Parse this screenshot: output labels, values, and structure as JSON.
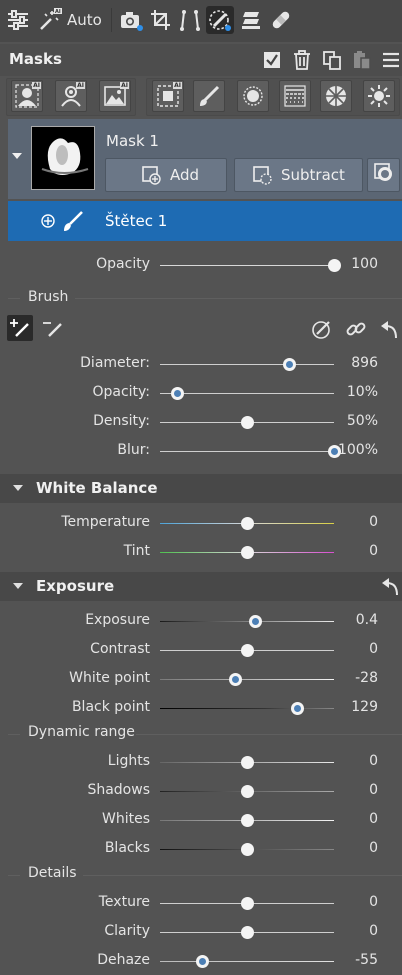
{
  "toolbar": {
    "auto_label": "Auto",
    "icons": [
      "sliders-icon",
      "magic-wand-icon",
      "camera-icon",
      "crop-icon",
      "perspective-icon",
      "mask-brush-icon",
      "layers-icon",
      "bandage-icon"
    ]
  },
  "masks": {
    "title": "Masks",
    "mask_name": "Mask 1",
    "add_label": "Add",
    "subtract_label": "Subtract",
    "brush_name": "Štětec 1"
  },
  "opacity": {
    "label": "Opacity",
    "value": "100",
    "fraction": 1.0
  },
  "brush": {
    "section_label": "Brush",
    "sliders": [
      {
        "label": "Diameter:",
        "value": "896",
        "fraction": 0.74,
        "blue": true
      },
      {
        "label": "Opacity:",
        "value": "10%",
        "fraction": 0.1,
        "blue": true
      },
      {
        "label": "Density:",
        "value": "50%",
        "fraction": 0.5,
        "blue": false
      },
      {
        "label": "Blur:",
        "value": "100%",
        "fraction": 1.0,
        "blue": true
      }
    ]
  },
  "white_balance": {
    "title": "White Balance",
    "sliders": [
      {
        "label": "Temperature",
        "value": "0",
        "fraction": 0.5
      },
      {
        "label": "Tint",
        "value": "0",
        "fraction": 0.5
      }
    ]
  },
  "exposure": {
    "title": "Exposure",
    "sliders": [
      {
        "label": "Exposure",
        "value": "0.4",
        "fraction": 0.545,
        "blue": true
      },
      {
        "label": "Contrast",
        "value": "0",
        "fraction": 0.5,
        "blue": false
      },
      {
        "label": "White point",
        "value": "-28",
        "fraction": 0.43,
        "blue": true
      },
      {
        "label": "Black point",
        "value": "129",
        "fraction": 0.79,
        "blue": true
      }
    ],
    "dynamic_range_label": "Dynamic range",
    "dynamic_range": [
      {
        "label": "Lights",
        "value": "0",
        "fraction": 0.5
      },
      {
        "label": "Shadows",
        "value": "0",
        "fraction": 0.5
      },
      {
        "label": "Whites",
        "value": "0",
        "fraction": 0.5
      },
      {
        "label": "Blacks",
        "value": "0",
        "fraction": 0.5
      }
    ],
    "details_label": "Details",
    "details": [
      {
        "label": "Texture",
        "value": "0",
        "fraction": 0.5,
        "blue": false
      },
      {
        "label": "Clarity",
        "value": "0",
        "fraction": 0.5,
        "blue": false
      },
      {
        "label": "Dehaze",
        "value": "-55",
        "fraction": 0.24,
        "blue": true
      }
    ]
  },
  "colors": {
    "accent": "#1e6bb3",
    "knob_dot": "#4c7fb5"
  }
}
